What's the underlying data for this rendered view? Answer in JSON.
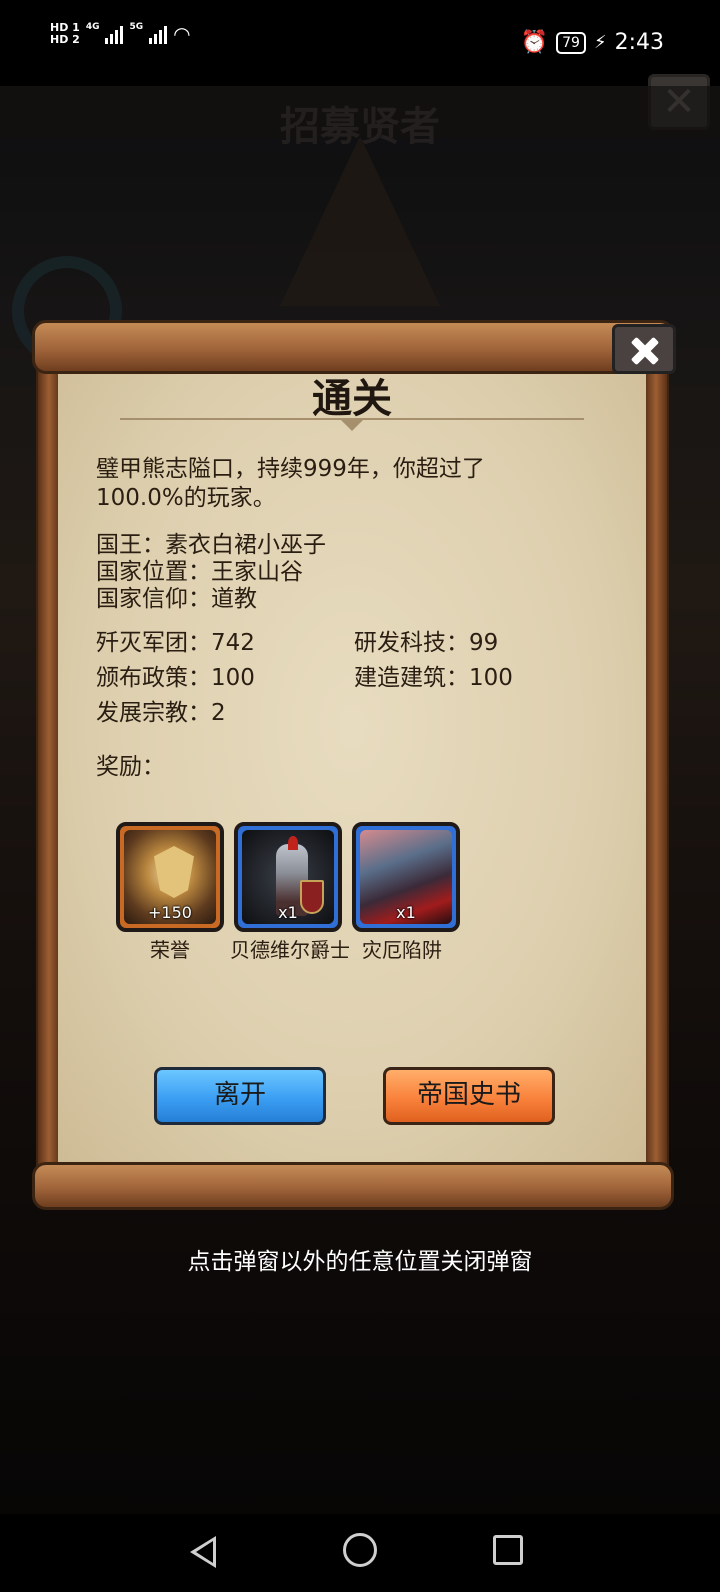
{
  "status_bar": {
    "hd1": "HD 1",
    "hd2": "HD 2",
    "net1": "4G",
    "net2": "5G",
    "battery": "79",
    "time": "2:43"
  },
  "background": {
    "title": "招募贤者"
  },
  "dialog": {
    "title": "通关",
    "summary": "璧甲熊志隘口，持续999年，你超过了100.0%的玩家。",
    "king": "国王：素衣白裙小巫子",
    "location": "国家位置：王家山谷",
    "faith": "国家信仰：道教",
    "stats": {
      "legions": "歼灭军团：742",
      "tech": "研发科技：99",
      "policies": "颁布政策：100",
      "buildings": "建造建筑：100",
      "religions": "发展宗教：2"
    },
    "rewards_label": "奖励：",
    "rewards": [
      {
        "count": "+150",
        "label": "荣誉",
        "icon": "honor-emblem-icon"
      },
      {
        "count": "x1",
        "label": "贝德维尔爵士",
        "icon": "knight-portrait-icon"
      },
      {
        "count": "x1",
        "label": "灾厄陷阱",
        "icon": "disaster-trap-icon"
      }
    ],
    "buttons": {
      "leave": "离开",
      "history": "帝国史书"
    }
  },
  "hint": "点击弹窗以外的任意位置关闭弹窗"
}
